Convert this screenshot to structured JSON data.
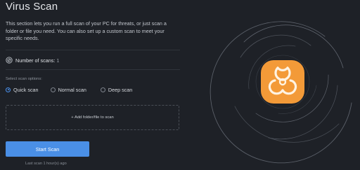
{
  "header": {
    "title": "Virus Scan",
    "description": "This section lets you run a full scan of your PC for threats, or just scan a folder or file you need. You can also set up a custom scan to meet your specific needs."
  },
  "stats": {
    "scans_label": "Number of scans:",
    "scans_value": "1"
  },
  "options": {
    "label": "Select scan options:",
    "items": [
      {
        "label": "Quick scan",
        "selected": true
      },
      {
        "label": "Normal scan",
        "selected": false
      },
      {
        "label": "Deep scan",
        "selected": false
      }
    ]
  },
  "dropzone": {
    "label": "+ Add folder/file to scan"
  },
  "actions": {
    "start_label": "Start Scan",
    "last_scan": "Last scan 1 hour(s) ago"
  },
  "icons": {
    "count": "scan-counter-icon",
    "hero": "biohazard-icon"
  },
  "colors": {
    "background": "#1e2127",
    "accent": "#4a8fe6",
    "hero_orange": "#f39a38"
  }
}
